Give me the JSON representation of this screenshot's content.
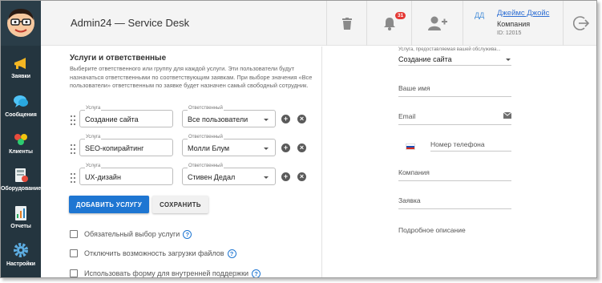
{
  "header": {
    "title": "Admin24 — Service Desk",
    "notifications_count": "31",
    "user": {
      "initials": "ДД",
      "name": "Джеймс Джойс",
      "company": "Компания",
      "id": "ID: 12015"
    }
  },
  "sidebar": {
    "items": [
      {
        "label": "Заявки",
        "icon": "megaphone-icon"
      },
      {
        "label": "Сообщения",
        "icon": "chat-icon"
      },
      {
        "label": "Клиенты",
        "icon": "clients-icon"
      },
      {
        "label": "Оборудование",
        "icon": "equipment-icon"
      },
      {
        "label": "Отчеты",
        "icon": "report-icon"
      },
      {
        "label": "Настройки",
        "icon": "gear-icon"
      }
    ]
  },
  "services": {
    "title": "Услуги и ответственные",
    "description": "Выберите ответственного или группу для каждой услуги. Эти пользователи будут назначаться ответственными по соответствующим заявкам. При выборе значения «Все пользователи» ответственным по заявке будет назначен самый свободный сотрудник.",
    "service_caption": "Услуга",
    "assignee_caption": "Ответственный",
    "rows": [
      {
        "service": "Создание сайта",
        "assignee": "Все пользователи"
      },
      {
        "service": "SEO-копирайтинг",
        "assignee": "Молли Блум"
      },
      {
        "service": "UX-дизайн",
        "assignee": "Стивен Дедал"
      }
    ],
    "add_button": "ДОБАВИТЬ УСЛУГУ",
    "save_button": "СОХРАНИТЬ",
    "checkboxes": [
      {
        "label": "Обязательный выбор услуги",
        "checked": false
      },
      {
        "label": "Отключить возможность загрузки файлов",
        "checked": false
      },
      {
        "label": "Использовать форму для внутренней поддержки",
        "checked": false
      }
    ]
  },
  "form": {
    "service_caption": "Услуга, предоставляемая вашей обслужива...",
    "service_value": "Создание сайта",
    "name_placeholder": "Ваше имя",
    "email_placeholder": "Email",
    "phone_placeholder": "Номер телефона",
    "company_placeholder": "Компания",
    "request_placeholder": "Заявка",
    "description_label": "Подробное описание"
  },
  "colors": {
    "sidebar": "#24353f",
    "primary": "#1e76d2",
    "badge": "#e53935"
  }
}
